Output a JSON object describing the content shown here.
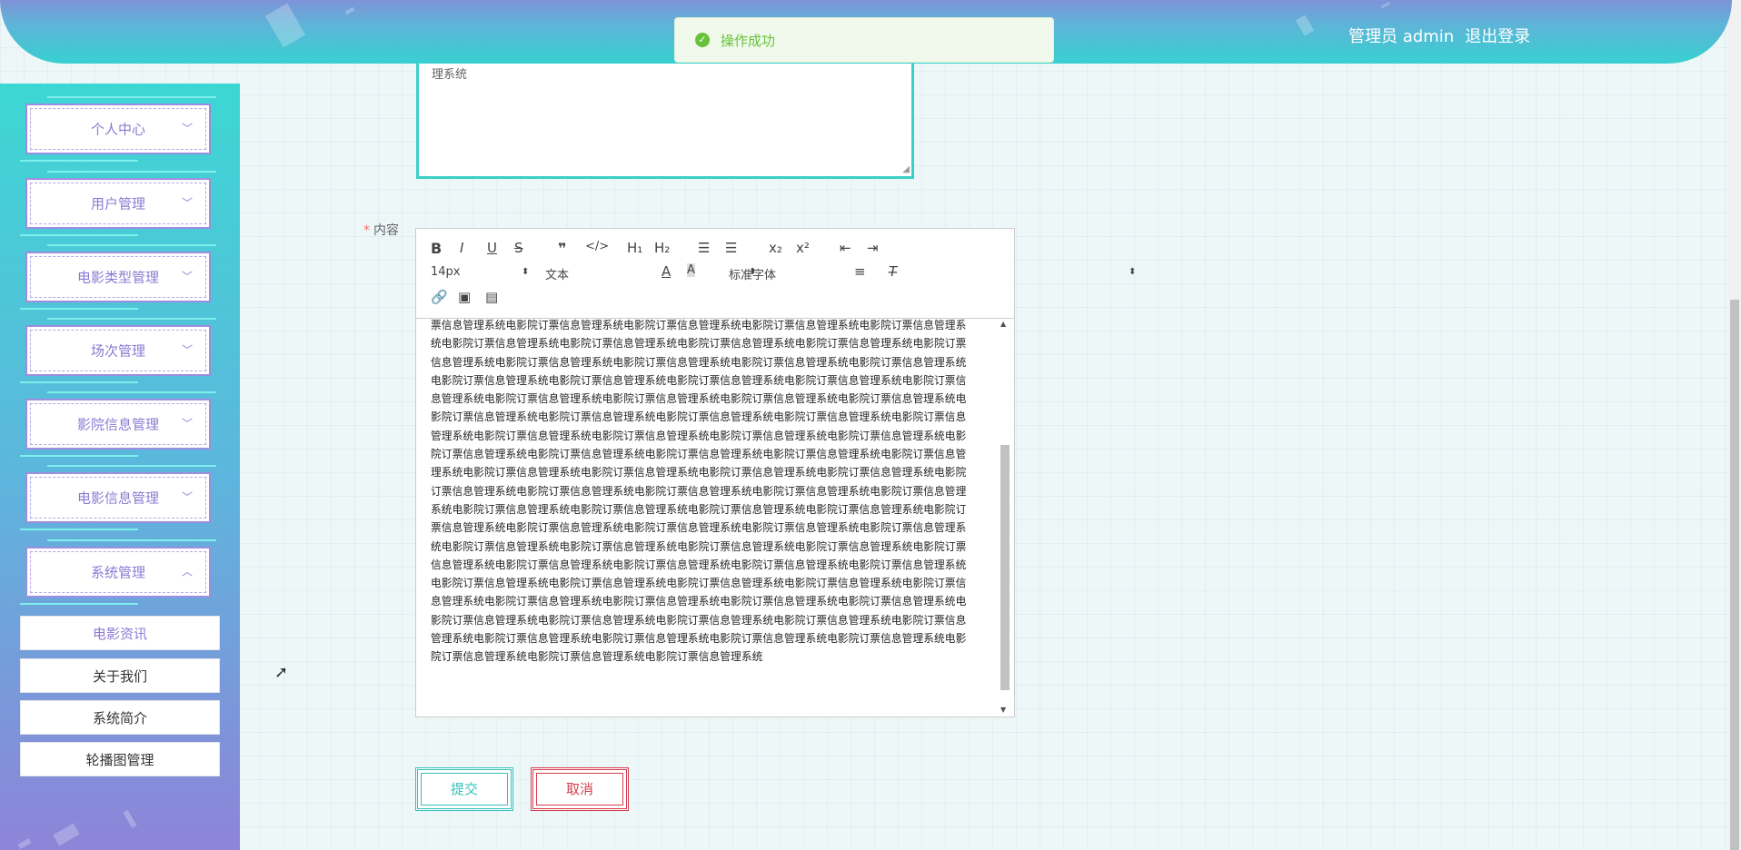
{
  "header": {
    "user_label": "管理员 admin",
    "logout_label": "退出登录"
  },
  "toast": {
    "message": "操作成功"
  },
  "sidebar": {
    "items": [
      {
        "label": "个人中心",
        "chevron": "chevron-down"
      },
      {
        "label": "用户管理",
        "chevron": "chevron-down"
      },
      {
        "label": "电影类型管理",
        "chevron": "chevron-down"
      },
      {
        "label": "场次管理",
        "chevron": "chevron-down"
      },
      {
        "label": "影院信息管理",
        "chevron": "chevron-down"
      },
      {
        "label": "电影信息管理",
        "chevron": "chevron-down"
      },
      {
        "label": "系统管理",
        "chevron": "chevron-up"
      }
    ],
    "sub_items": [
      {
        "label": "电影资讯",
        "active": true
      },
      {
        "label": "关于我们",
        "active": false
      },
      {
        "label": "系统简介",
        "active": false
      },
      {
        "label": "轮播图管理",
        "active": false
      }
    ]
  },
  "form": {
    "textarea_value": "理系统",
    "content_label": "内容",
    "editor": {
      "font_size": "14px",
      "paragraph": "文本",
      "font_family": "标准字体",
      "content_text": "票信息管理系统电影院订票信息管理系统电影院订票信息管理系统电影院订票信息管理系统电影院订票信息管理系统电影院订票信息管理系统电影院订票信息管理系统电影院订票信息管理系统电影院订票信息管理系统电影院订票信息管理系统电影院订票信息管理系统电影院订票信息管理系统电影院订票信息管理系统电影院订票信息管理系统电影院订票信息管理系统电影院订票信息管理系统电影院订票信息管理系统电影院订票信息管理系统电影院订票信息管理系统电影院订票信息管理系统电影院订票信息管理系统电影院订票信息管理系统电影院订票信息管理系统电影院订票信息管理系统电影院订票信息管理系统电影院订票信息管理系统电影院订票信息管理系统电影院订票信息管理系统电影院订票信息管理系统电影院订票信息管理系统电影院订票信息管理系统电影院订票信息管理系统电影院订票信息管理系统电影院订票信息管理系统电影院订票信息管理系统电影院订票信息管理系统电影院订票信息管理系统电影院订票信息管理系统电影院订票信息管理系统电影院订票信息管理系统电影院订票信息管理系统电影院订票信息管理系统电影院订票信息管理系统电影院订票信息管理系统电影院订票信息管理系统电影院订票信息管理系统电影院订票信息管理系统电影院订票信息管理系统电影院订票信息管理系统电影院订票信息管理系统电影院订票信息管理系统电影院订票信息管理系统电影院订票信息管理系统电影院订票信息管理系统电影院订票信息管理系统电影院订票信息管理系统电影院订票信息管理系统电影院订票信息管理系统电影院订票信息管理系统电影院订票信息管理系统电影院订票信息管理系统电影院订票信息管理系统电影院订票信息管理系统电影院订票信息管理系统电影院订票信息管理系统电影院订票信息管理系统电影院订票信息管理系统电影院订票信息管理系统电影院订票信息管理系统电影院订票信息管理系统电影院订票信息管理系统电影院订票信息管理系统电影院订票信息管理系统电影院订票信息管理系统电影院订票信息管理系统电影院订票信息管理系统电影院订票信息管理系统电影院订票信息管理系统电影院订票信息管理系统电影院订票信息管理系统电影院订票信息管理系统电影院订票信息管理系统电影院订票信息管理系统电影院订票信息管理系统电影院订票信息管理系统"
    },
    "submit_label": "提交",
    "cancel_label": "取消"
  },
  "colors": {
    "accent_teal": "#34c1bb",
    "accent_red": "#d33d4e",
    "menu_text": "#8c7ad3",
    "success": "#67c23a"
  }
}
